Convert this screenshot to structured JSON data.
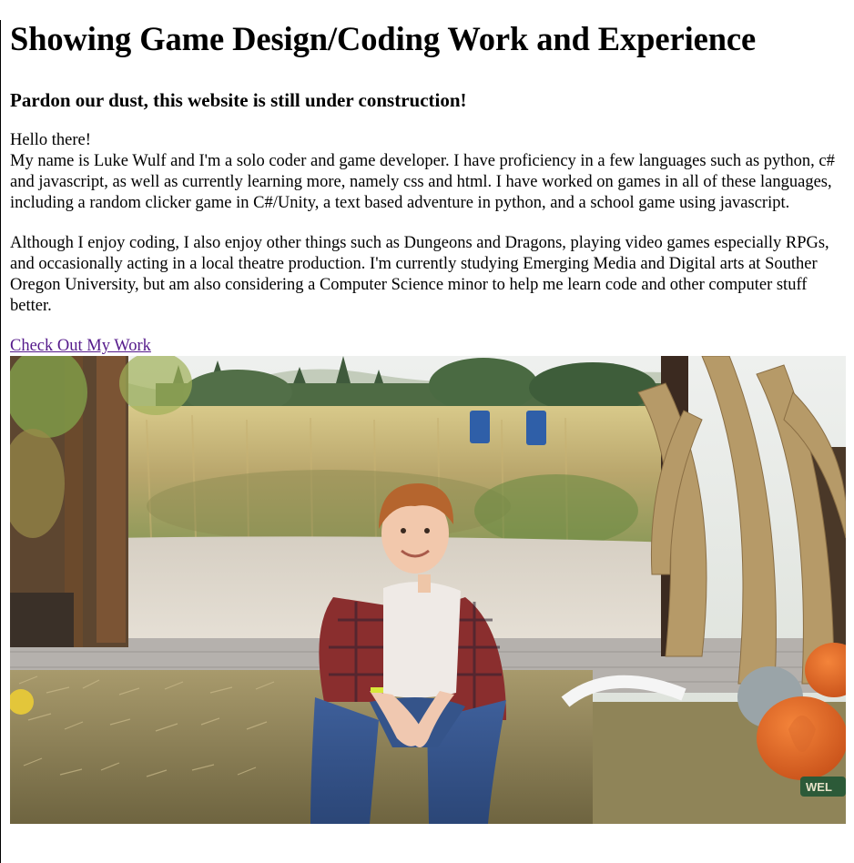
{
  "page": {
    "title": "Showing Game Design/Coding Work and Experience",
    "subtitle": "Pardon our dust, this website is still under construction!",
    "greeting": "Hello there!",
    "intro": "My name is Luke Wulf and I'm a solo coder and game developer. I have proficiency in a few languages such as python, c# and javascript, as well as currently learning more, namely css and html. I have worked on games in all of these languages, including a random clicker game in C#/Unity, a text based adventure in python, and a school game using javascript.",
    "about": "Although I enjoy coding, I also enjoy other things such as Dungeons and Dragons, playing video games especially RPGs, and occasionally acting in a local theatre production. I'm currently studying Emerging Media and Digital arts at Souther Oregon University, but am also considering a Computer Science minor to help me learn code and other computer stuff better.",
    "work_link": "Check Out My Work",
    "photo_sign": "WEL"
  },
  "colors": {
    "link_visited": "#551a8b",
    "pumpkin": "#e8641e",
    "sky": "#e6ebe6"
  }
}
